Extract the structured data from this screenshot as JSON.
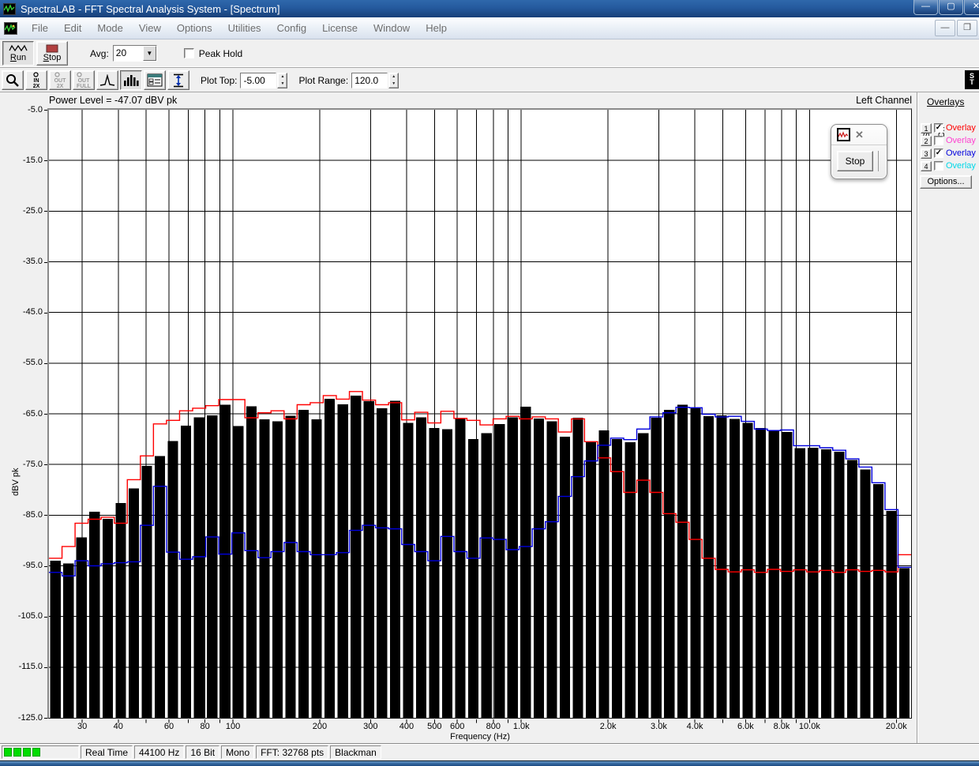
{
  "window": {
    "title": "SpectraLAB - FFT Spectral Analysis System - [Spectrum]",
    "controls": {
      "minimize": "—",
      "maximize": "▢",
      "close": "✕"
    },
    "mdi_controls": {
      "minimize": "—",
      "restore": "❐"
    }
  },
  "menu": {
    "items": [
      "File",
      "Edit",
      "Mode",
      "View",
      "Options",
      "Utilities",
      "Config",
      "License",
      "Window",
      "Help"
    ]
  },
  "toolbar": {
    "run_label": "Run",
    "stop_label": "Stop",
    "avg_label": "Avg:",
    "avg_value": "20",
    "peak_hold_label": "Peak Hold",
    "peak_hold_checked": false
  },
  "toolbar2": {
    "buttons": [
      {
        "name": "zoom-cursor-button",
        "icon": "magnifier",
        "top": "",
        "bottom": "",
        "state": "raised"
      },
      {
        "name": "zoom-in-2x-button",
        "icon": "zoom-in-2x",
        "top": "IN",
        "bottom": "2X",
        "state": "raised"
      },
      {
        "name": "zoom-out-2x-button",
        "icon": "zoom-out-2x",
        "top": "OUT",
        "bottom": "2X",
        "state": "disabled"
      },
      {
        "name": "zoom-out-full-button",
        "icon": "zoom-out-full",
        "top": "OUT",
        "bottom": "FULL",
        "state": "disabled"
      },
      {
        "name": "peak-curve-button",
        "icon": "peak-curve",
        "top": "",
        "bottom": "",
        "state": "raised"
      },
      {
        "name": "bar-display-button",
        "icon": "bar-chart",
        "top": "",
        "bottom": "",
        "state": "pressed"
      },
      {
        "name": "display-options-button",
        "icon": "list-window",
        "top": "",
        "bottom": "",
        "state": "raised"
      },
      {
        "name": "vertical-range-button",
        "icon": "updown-arrow",
        "top": "",
        "bottom": "",
        "state": "raised"
      }
    ],
    "plot_top_label": "Plot Top:",
    "plot_top_value": "-5.00",
    "plot_range_label": "Plot Range:",
    "plot_range_value": "120.0"
  },
  "plot": {
    "power_level": "Power Level = -47.07 dBV pk",
    "channel": "Left Channel",
    "ylabel": "dBV pk",
    "xlabel": "Frequency (Hz)"
  },
  "overlays": {
    "title": "Overlays",
    "set_label": "Set",
    "on_label": "On",
    "options_label": "Options...",
    "rows": [
      {
        "num": "1",
        "checked": true,
        "label": "Overlay",
        "color": "#ff0000"
      },
      {
        "num": "2",
        "checked": false,
        "label": "Overlay",
        "color": "#ff40d0"
      },
      {
        "num": "3",
        "checked": true,
        "label": "Overlay",
        "color": "#0000dd"
      },
      {
        "num": "4",
        "checked": false,
        "label": "Overlay",
        "color": "#00d8e8"
      }
    ]
  },
  "mini_dialog": {
    "stop_label": "Stop",
    "close_glyph": "✕"
  },
  "status_bar": {
    "vu_blocks": 4,
    "segments": [
      "Real Time",
      "44100 Hz",
      "16 Bit",
      "Mono",
      "FFT: 32768 pts",
      "Blackman"
    ]
  },
  "chart_data": {
    "type": "bar",
    "title": "Power Level = -47.07 dBV pk",
    "xlabel": "Frequency (Hz)",
    "ylabel": "dBV pk",
    "x_scale": "log",
    "x_range_hz": [
      23,
      22500
    ],
    "y_range_db": [
      -125,
      -5
    ],
    "grid": true,
    "y_grid_db": [
      -15,
      -25,
      -35,
      -45,
      -55,
      -65,
      -75,
      -85,
      -95,
      -105,
      -115
    ],
    "y_tick_db": [
      -5,
      -15,
      -25,
      -35,
      -45,
      -55,
      -65,
      -75,
      -85,
      -95,
      -105,
      -115,
      -125
    ],
    "y_tick_labels": [
      "-5.0",
      "-15.0",
      "-25.0",
      "-35.0",
      "-45.0",
      "-55.0",
      "-65.0",
      "-75.0",
      "-85.0",
      "-95.0",
      "-105.0",
      "-115.0",
      "-125.0"
    ],
    "grid_freqs": [
      30,
      40,
      50,
      60,
      70,
      80,
      90,
      100,
      200,
      300,
      400,
      500,
      600,
      700,
      800,
      900,
      1000,
      2000,
      3000,
      4000,
      5000,
      6000,
      7000,
      8000,
      9000,
      10000,
      20000
    ],
    "x_tick_labels": [
      {
        "f": 30,
        "t": "30"
      },
      {
        "f": 40,
        "t": "40"
      },
      {
        "f": 60,
        "t": "60"
      },
      {
        "f": 80,
        "t": "80"
      },
      {
        "f": 100,
        "t": "100"
      },
      {
        "f": 200,
        "t": "200"
      },
      {
        "f": 300,
        "t": "300"
      },
      {
        "f": 400,
        "t": "400"
      },
      {
        "f": 500,
        "t": "500"
      },
      {
        "f": 600,
        "t": "600"
      },
      {
        "f": 800,
        "t": "800"
      },
      {
        "f": 1000,
        "t": "1.0k"
      },
      {
        "f": 2000,
        "t": "2.0k"
      },
      {
        "f": 3000,
        "t": "3.0k"
      },
      {
        "f": 4000,
        "t": "4.0k"
      },
      {
        "f": 6000,
        "t": "6.0k"
      },
      {
        "f": 8000,
        "t": "8.0k"
      },
      {
        "f": 10000,
        "t": "10.0k"
      },
      {
        "f": 20000,
        "t": "20.0k"
      }
    ],
    "band_center_hz": [
      23,
      25.5,
      28.3,
      31.5,
      34.9,
      38.8,
      43,
      47.8,
      53,
      58.9,
      65.3,
      72.5,
      80.5,
      89.3,
      99.2,
      110,
      122,
      136,
      150,
      167,
      186,
      206,
      228,
      254,
      281,
      312,
      347,
      385,
      427,
      474,
      527,
      584,
      649,
      720,
      799,
      887,
      985,
      1093,
      1213,
      1347,
      1495,
      1659,
      1842,
      2044,
      2269,
      2519,
      2796,
      3103,
      3445,
      3824,
      4244,
      4711,
      5229,
      5805,
      6443,
      7152,
      7939,
      8812,
      9781,
      10857,
      12051,
      13377,
      14849,
      16482,
      18295,
      20307
    ],
    "series": [
      {
        "name": "live-average-spectrum",
        "type": "bar",
        "color": "#000000",
        "values_db": [
          -94.0,
          -94.5,
          -89.4,
          -84.3,
          -85.7,
          -82.6,
          -79.7,
          -75.3,
          -73.3,
          -70.4,
          -67.3,
          -65.7,
          -65.3,
          -63.2,
          -67.4,
          -63.5,
          -66.1,
          -66.5,
          -65.4,
          -64.2,
          -66.1,
          -62.0,
          -63.1,
          -61.4,
          -62.5,
          -63.9,
          -62.4,
          -66.8,
          -65.7,
          -67.8,
          -68.0,
          -65.9,
          -70.0,
          -68.8,
          -67.0,
          -65.7,
          -63.6,
          -65.9,
          -66.5,
          -69.5,
          -65.8,
          -70.5,
          -68.3,
          -70.0,
          -70.6,
          -68.8,
          -65.8,
          -64.2,
          -63.2,
          -63.9,
          -65.5,
          -65.3,
          -66.0,
          -66.8,
          -67.8,
          -68.2,
          -68.6,
          -71.8,
          -71.7,
          -72.0,
          -72.5,
          -74.1,
          -76.0,
          -78.9,
          -84.2,
          -95.5
        ]
      },
      {
        "name": "overlay-1",
        "type": "step-line",
        "color": "#ff0000",
        "values_db": [
          -93.5,
          -91.2,
          -86.6,
          -85.8,
          -85.4,
          -86.6,
          -78.0,
          -73.3,
          -67.0,
          -66.3,
          -64.4,
          -63.9,
          -63.4,
          -62.2,
          -62.2,
          -65.8,
          -64.8,
          -64.4,
          -66.0,
          -63.2,
          -62.8,
          -61.4,
          -62.1,
          -60.6,
          -62.3,
          -63.2,
          -62.8,
          -66.2,
          -64.7,
          -66.8,
          -64.5,
          -65.9,
          -66.3,
          -67.2,
          -66.0,
          -65.5,
          -66.0,
          -65.6,
          -66.0,
          -68.6,
          -66.0,
          -70.5,
          -73.7,
          -76.4,
          -80.5,
          -78.1,
          -80.5,
          -84.7,
          -86.4,
          -89.8,
          -93.5,
          -95.7,
          -96.2,
          -95.8,
          -96.3,
          -95.7,
          -96.1,
          -95.8,
          -96.2,
          -95.9,
          -96.3,
          -95.8,
          -96.1,
          -95.9,
          -96.2,
          -92.8
        ]
      },
      {
        "name": "overlay-3",
        "type": "step-line",
        "color": "#0000dd",
        "values_db": [
          -96.3,
          -97.0,
          -94.0,
          -95.0,
          -94.6,
          -94.4,
          -94.2,
          -87.0,
          -79.3,
          -92.3,
          -93.7,
          -93.2,
          -89.3,
          -92.7,
          -88.5,
          -92.0,
          -93.4,
          -92.2,
          -90.4,
          -92.2,
          -92.8,
          -92.8,
          -92.4,
          -88.0,
          -87.0,
          -87.5,
          -87.7,
          -90.8,
          -92.2,
          -94.0,
          -89.2,
          -92.2,
          -93.5,
          -89.5,
          -89.8,
          -91.8,
          -91.2,
          -87.7,
          -86.3,
          -81.3,
          -77.4,
          -74.3,
          -71.2,
          -69.8,
          -70.1,
          -68.0,
          -65.6,
          -64.8,
          -63.7,
          -63.8,
          -65.1,
          -65.6,
          -65.5,
          -66.5,
          -68.0,
          -68.3,
          -68.2,
          -71.3,
          -71.3,
          -71.7,
          -72.2,
          -73.9,
          -75.5,
          -78.6,
          -83.9,
          -95.3
        ]
      }
    ]
  }
}
